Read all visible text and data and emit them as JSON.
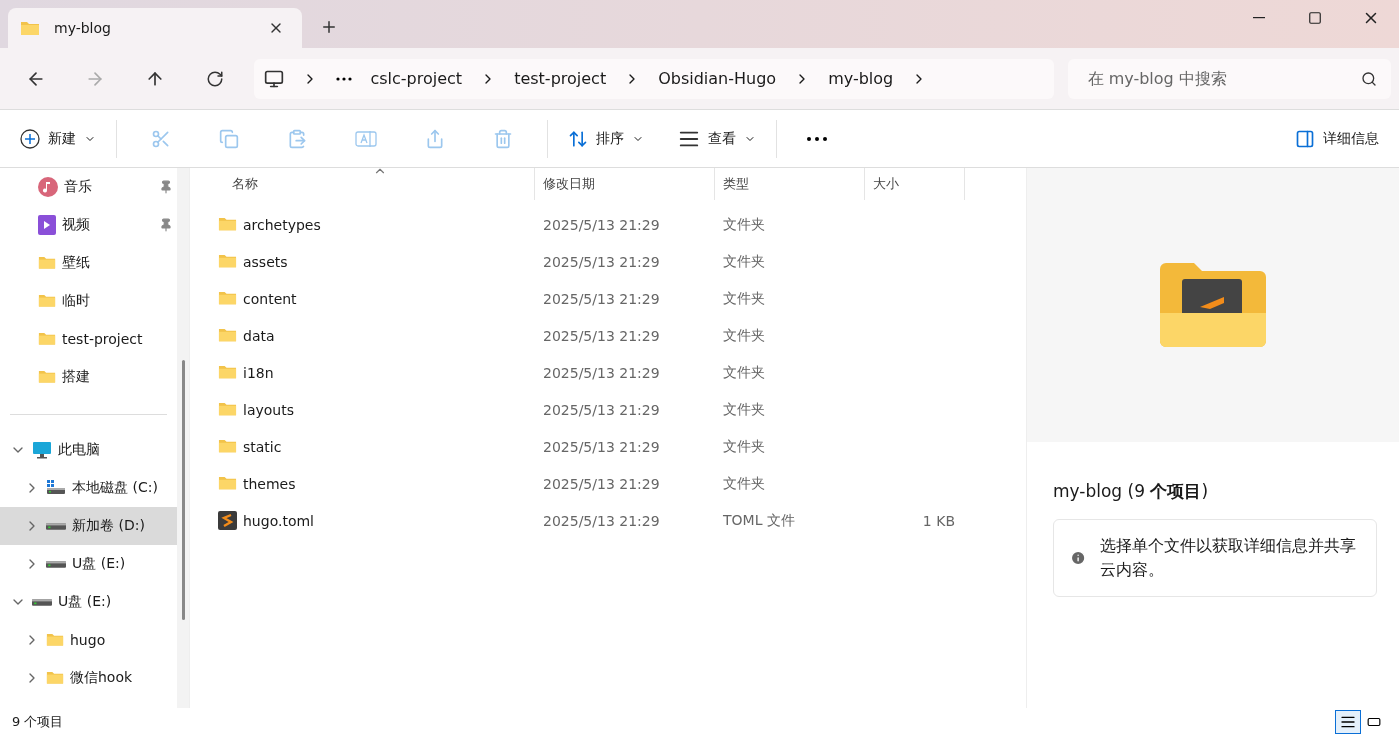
{
  "tabs": [
    {
      "title": "my-blog",
      "selected": true
    }
  ],
  "breadcrumb": [
    "cslc-project",
    "test-project",
    "Obsidian-Hugo",
    "my-blog"
  ],
  "search": {
    "placeholder": "在 my-blog 中搜索"
  },
  "toolbar": {
    "new_label": "新建",
    "sort_label": "排序",
    "view_label": "查看",
    "details_label": "详细信息"
  },
  "quick_access": [
    {
      "label": "音乐",
      "kind": "music",
      "pinned": true
    },
    {
      "label": "视频",
      "kind": "video",
      "pinned": true
    },
    {
      "label": "壁纸",
      "kind": "folder",
      "pinned": false
    },
    {
      "label": "临时",
      "kind": "folder",
      "pinned": false
    },
    {
      "label": "test-project",
      "kind": "folder",
      "pinned": false
    },
    {
      "label": "搭建",
      "kind": "folder",
      "pinned": false
    }
  ],
  "tree": [
    {
      "label": "此电脑",
      "kind": "pc",
      "expanded": true,
      "selected": false,
      "children": [
        {
          "label": "本地磁盘 (C:)",
          "kind": "sysdrive",
          "expanded": false,
          "selected": false
        },
        {
          "label": "新加卷 (D:)",
          "kind": "drive",
          "expanded": false,
          "selected": true
        },
        {
          "label": "U盘 (E:)",
          "kind": "drive",
          "expanded": false,
          "selected": false
        }
      ]
    },
    {
      "label": "U盘 (E:)",
      "kind": "drive",
      "expanded": true,
      "selected": false,
      "children": [
        {
          "label": "hugo",
          "kind": "folder",
          "expanded": false,
          "selected": false
        },
        {
          "label": "微信hook",
          "kind": "folder",
          "expanded": false,
          "selected": false
        }
      ]
    }
  ],
  "table": {
    "columns": [
      "名称",
      "修改日期",
      "类型",
      "大小"
    ],
    "rows": [
      {
        "name": "archetypes",
        "kind": "folder",
        "date": "2025/5/13 21:29",
        "type": "文件夹"
      },
      {
        "name": "assets",
        "kind": "folder",
        "date": "2025/5/13 21:29",
        "type": "文件夹"
      },
      {
        "name": "content",
        "kind": "folder",
        "date": "2025/5/13 21:29",
        "type": "文件夹"
      },
      {
        "name": "data",
        "kind": "folder",
        "date": "2025/5/13 21:29",
        "type": "文件夹"
      },
      {
        "name": "i18n",
        "kind": "folder",
        "date": "2025/5/13 21:29",
        "type": "文件夹"
      },
      {
        "name": "layouts",
        "kind": "folder",
        "date": "2025/5/13 21:29",
        "type": "文件夹"
      },
      {
        "name": "static",
        "kind": "folder",
        "date": "2025/5/13 21:29",
        "type": "文件夹"
      },
      {
        "name": "themes",
        "kind": "folder",
        "date": "2025/5/13 21:29",
        "type": "文件夹"
      },
      {
        "name": "hugo.toml",
        "kind": "file",
        "date": "2025/5/13 21:29",
        "type": "TOML 文件",
        "size": "1 KB"
      }
    ]
  },
  "details": {
    "title": "my-blog (9 **个项目**)",
    "info": "选择单个文件以获取详细信息并共享云内容。"
  },
  "status_bar": {
    "count": "9 个项目",
    "view_buttons": [
      {
        "kind": "details",
        "selected": true
      },
      {
        "kind": "tiles",
        "selected": false
      }
    ]
  }
}
